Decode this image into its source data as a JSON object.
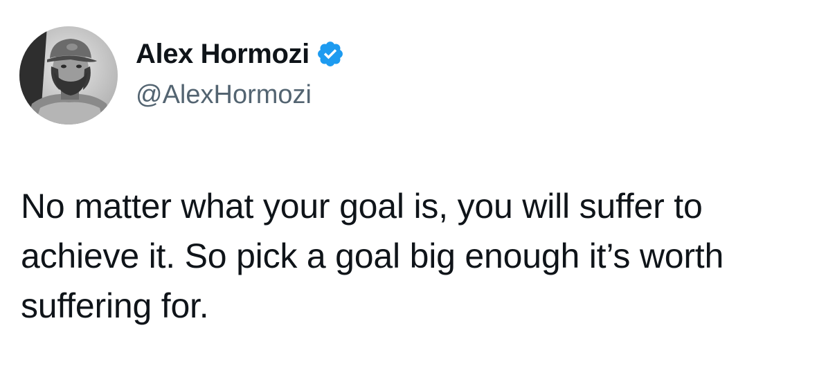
{
  "tweet": {
    "author": {
      "display_name": "Alex Hormozi",
      "handle": "@AlexHormozi",
      "verified": true,
      "avatar": "profile-photo-man-with-cap-and-beard"
    },
    "text": "No matter what your goal is, you will suffer to achieve it. So pick a goal big enough it’s worth suffering for."
  },
  "colors": {
    "text_primary": "#0f1419",
    "text_secondary": "#536471",
    "verified_blue": "#1d9bf0",
    "background": "#ffffff"
  },
  "icons": {
    "verified": "verified-checkmark-icon"
  }
}
